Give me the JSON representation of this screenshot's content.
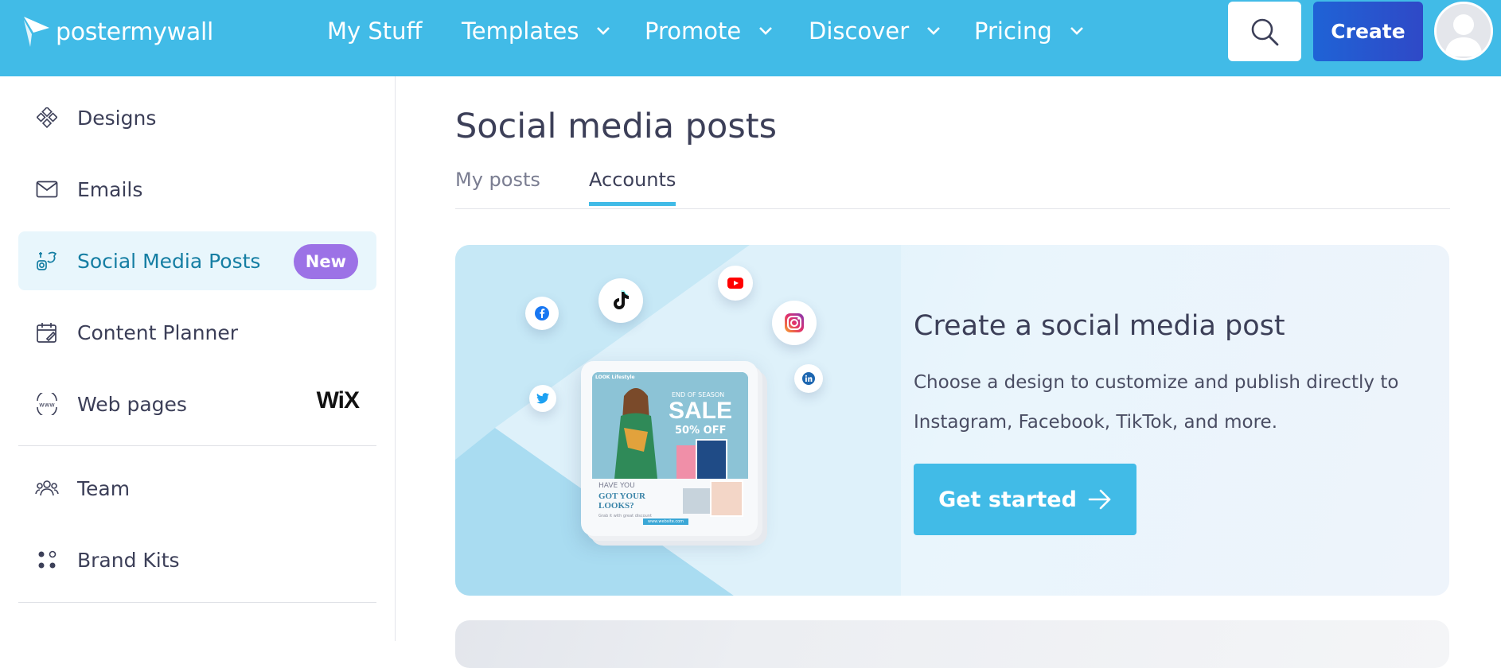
{
  "brand": {
    "logo_text": "postermywall"
  },
  "nav": {
    "items": [
      {
        "label": "My Stuff",
        "dropdown": false
      },
      {
        "label": "Templates",
        "dropdown": true
      },
      {
        "label": "Promote",
        "dropdown": true
      },
      {
        "label": "Discover",
        "dropdown": true
      },
      {
        "label": "Pricing",
        "dropdown": true
      }
    ],
    "search_icon": "search-icon",
    "create_label": "Create",
    "accent_color": "#41bbe7"
  },
  "sidebar": {
    "items": [
      {
        "label": "Designs",
        "icon": "designs-icon"
      },
      {
        "label": "Emails",
        "icon": "envelope-icon"
      },
      {
        "label": "Social Media Posts",
        "icon": "social-icon",
        "active": true,
        "badge": "New"
      },
      {
        "label": "Content Planner",
        "icon": "calendar-icon"
      },
      {
        "label": "Web pages",
        "icon": "www-icon",
        "partner": "WiX"
      },
      {
        "label": "Team",
        "icon": "team-icon"
      },
      {
        "label": "Brand Kits",
        "icon": "brand-kits-icon"
      }
    ]
  },
  "main": {
    "title": "Social media posts",
    "tabs": [
      {
        "label": "My posts",
        "active": false
      },
      {
        "label": "Accounts",
        "active": true
      }
    ],
    "hero": {
      "title": "Create a social media post",
      "description": "Choose a design to customize and publish directly to Instagram, Facebook, TikTok, and more.",
      "cta_label": "Get started",
      "poster": {
        "brand": "LOOK Lifestyle",
        "tagline": "END OF SEASON",
        "headline": "SALE",
        "discount": "50% OFF",
        "subhead_1": "HAVE YOU",
        "subhead_2": "GOT YOUR LOOKS?",
        "footnote": "Grab it with great discount",
        "url": "www.website.com"
      }
    }
  }
}
